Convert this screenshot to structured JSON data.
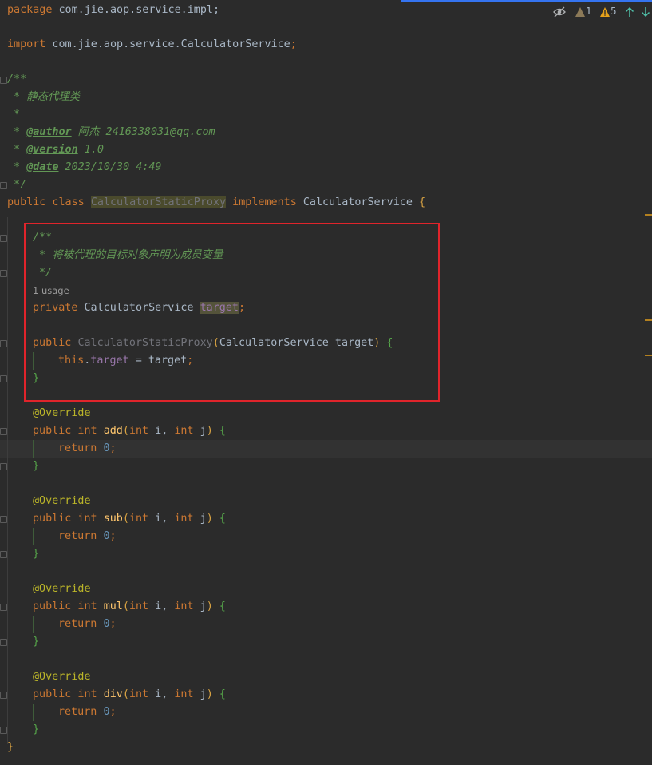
{
  "inspections": {
    "weak_warnings": "1",
    "warnings": "5"
  },
  "code": {
    "package_kw": "package",
    "package_name": " com.jie.aop.service.impl;",
    "import_kw": "import",
    "import_name": " com.jie.aop.service.CalculatorService",
    "semicolon": ";",
    "doc_open": "/**",
    "doc_desc": " * 静态代理类",
    "doc_blank": " *",
    "doc_star": " * ",
    "author_tag": "@author",
    "author_val": " 阿杰 2416338031@qq.com",
    "version_tag": "@version",
    "version_val": " 1.0",
    "date_tag": "@date",
    "date_val": " 2023/10/30 4:49",
    "doc_close": " */",
    "public_class": "public class ",
    "class_name": "CalculatorStaticProxy",
    "implements": " implements ",
    "interface_name": "CalculatorService",
    "open_brace": " {",
    "field_doc_open": "/**",
    "field_doc_desc": " * 将被代理的目标对象声明为成员变量",
    "field_doc_close": " */",
    "usage_hint": "1 usage",
    "private_kw": "private ",
    "field_type": "CalculatorService ",
    "field_name": "target",
    "public_kw": "public ",
    "ctor_name": "CalculatorStaticProxy",
    "ctor_params": "CalculatorService target",
    "this_kw": "this",
    "assign": ".",
    "assign_field": "target",
    "assign_rest": " = target",
    "close_brace": "}",
    "override": "@Override",
    "public_int": "public int ",
    "int_kw": "int",
    "param_i": " i, ",
    "param_j": " j",
    "return_kw": "return ",
    "zero": "0",
    "methods": [
      "add",
      "sub",
      "mul",
      "div"
    ]
  },
  "colors": {
    "background": "#2b2b2b",
    "keyword": "#cc7832",
    "doc_comment": "#629755",
    "annotation": "#bbb529",
    "method": "#ffc66d",
    "number": "#6897bb",
    "field": "#9876aa",
    "highlight_box": "#e0242b"
  }
}
